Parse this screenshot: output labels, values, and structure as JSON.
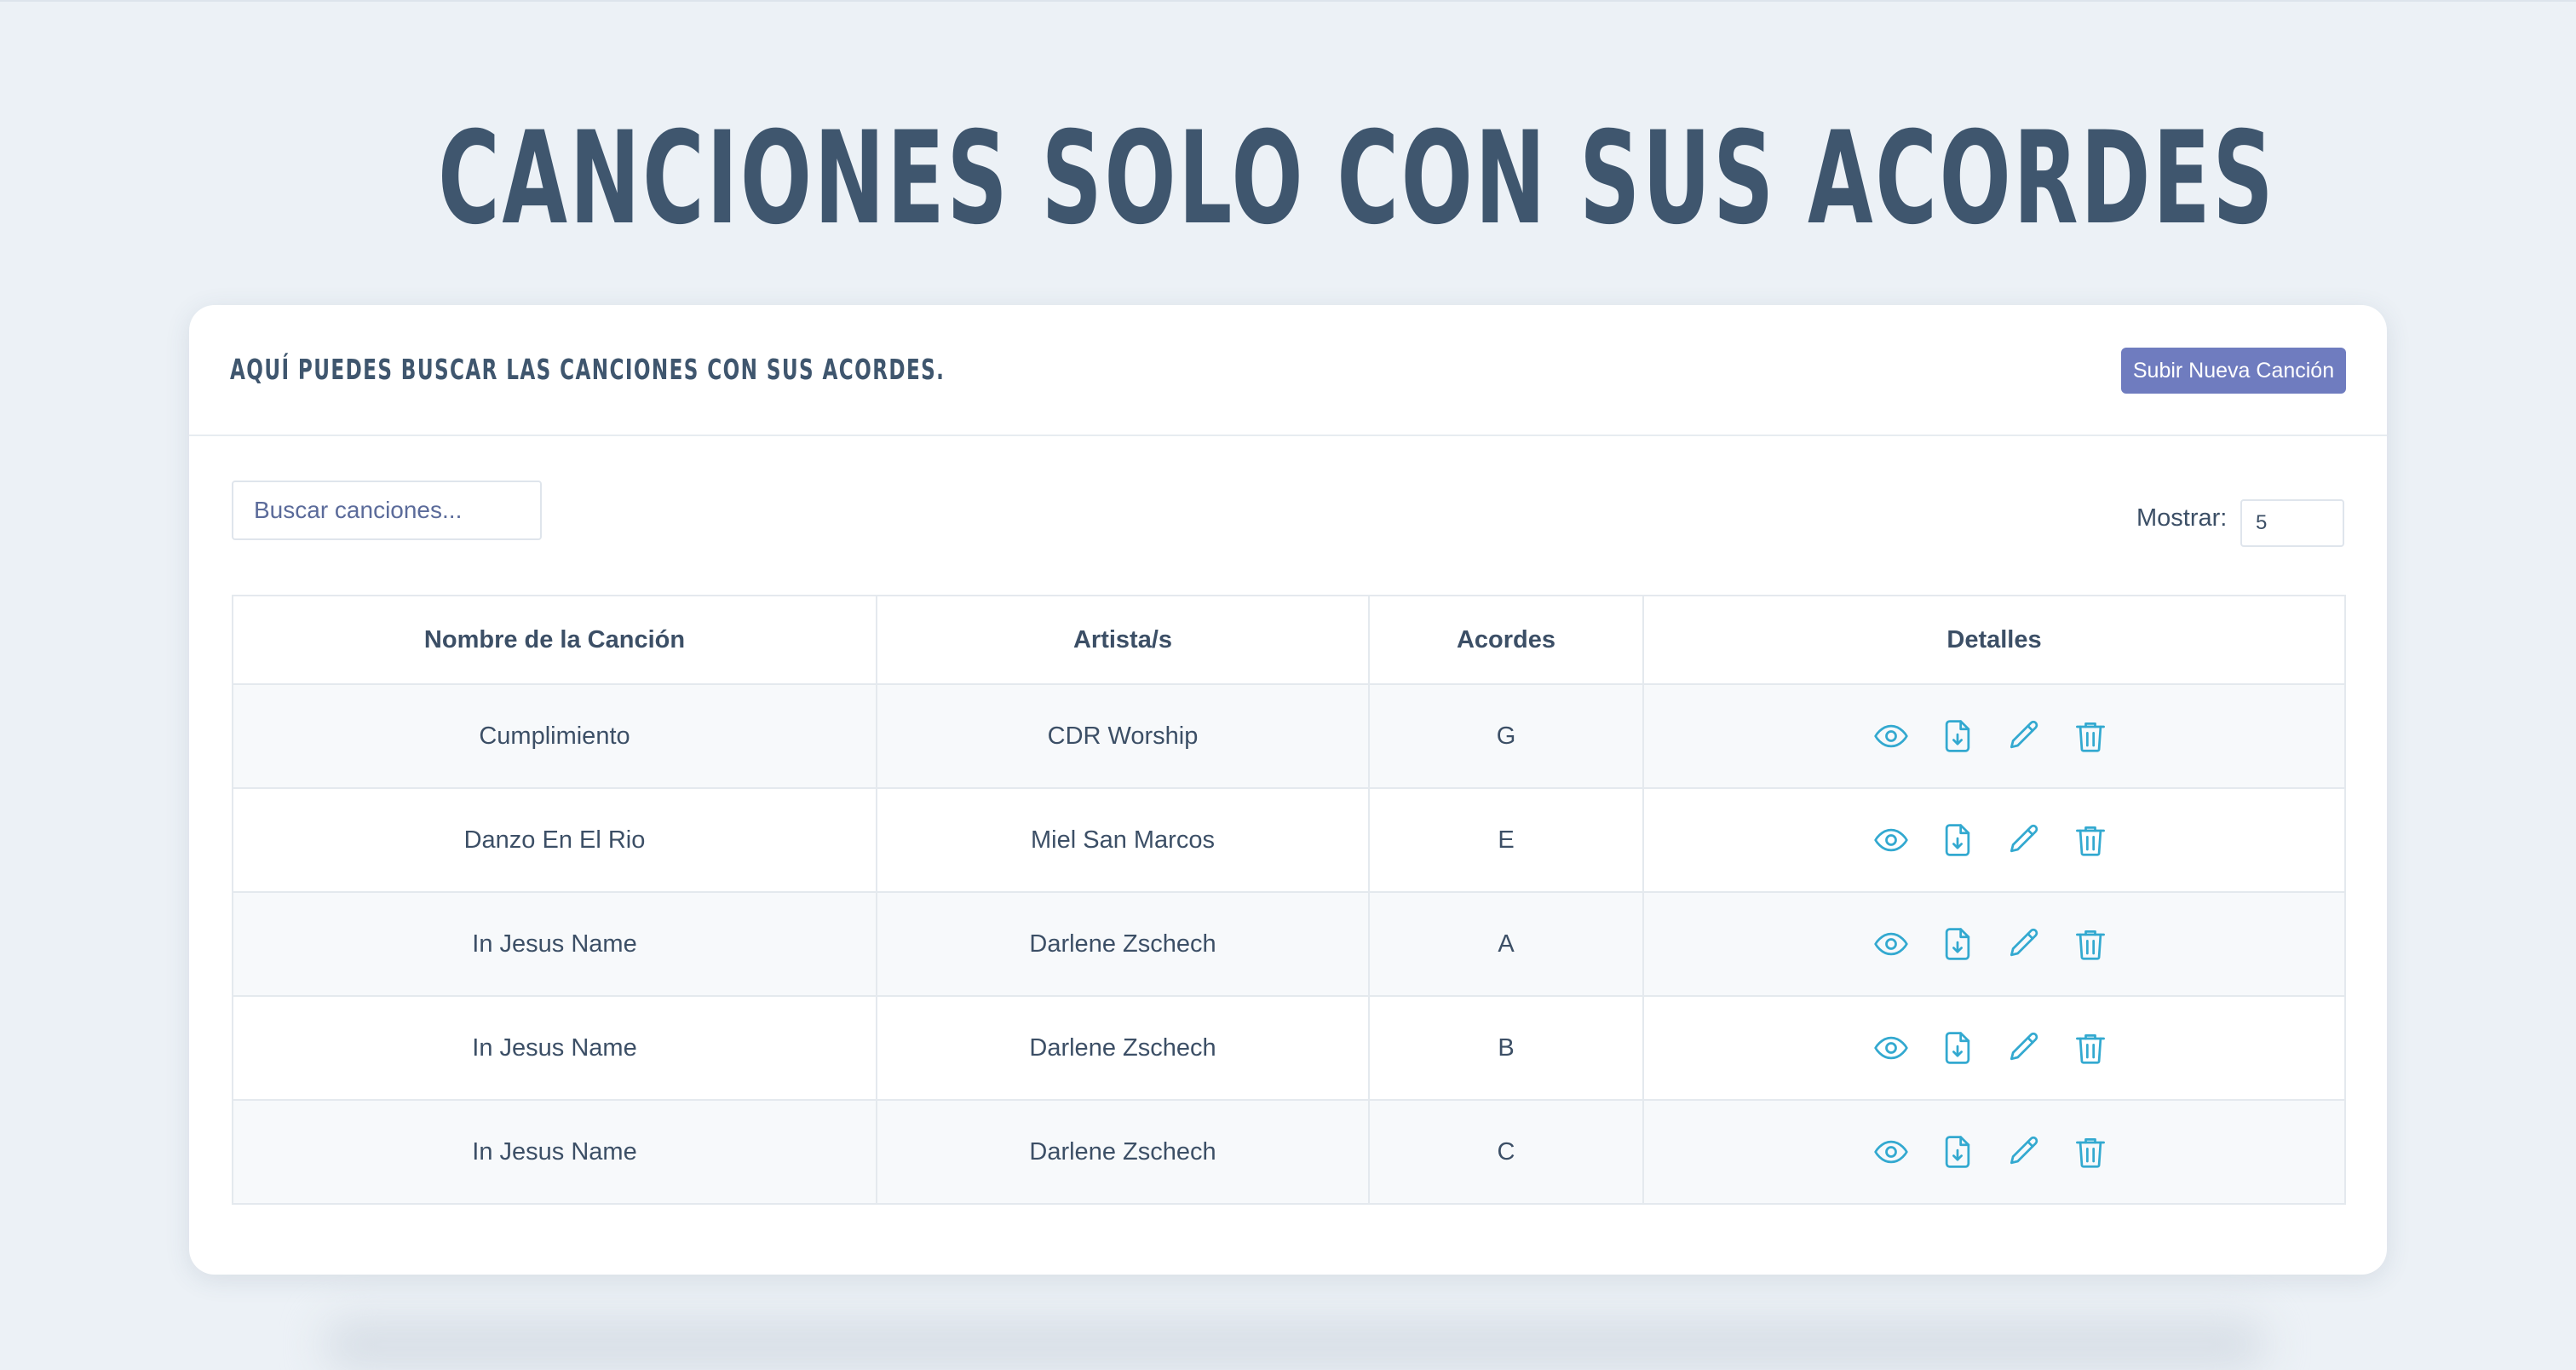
{
  "page": {
    "title": "CANCIONES SOLO CON SUS ACORDES"
  },
  "card": {
    "subtitle": "AQUÍ PUEDES BUSCAR LAS CANCIONES CON SUS ACORDES.",
    "upload_label": "Subir Nueva Canción"
  },
  "search": {
    "placeholder": "Buscar canciones...",
    "value": ""
  },
  "show": {
    "label": "Mostrar:",
    "value": "5"
  },
  "table": {
    "headers": [
      "Nombre de la Canción",
      "Artista/s",
      "Acordes",
      "Detalles"
    ],
    "rows": [
      {
        "name": "Cumplimiento",
        "artist": "CDR Worship",
        "chord": "G"
      },
      {
        "name": "Danzo En El Rio",
        "artist": "Miel San Marcos",
        "chord": "E"
      },
      {
        "name": "In Jesus Name",
        "artist": "Darlene Zschech",
        "chord": "A"
      },
      {
        "name": "In Jesus Name",
        "artist": "Darlene Zschech",
        "chord": "B"
      },
      {
        "name": "In Jesus Name",
        "artist": "Darlene Zschech",
        "chord": "C"
      }
    ],
    "row_actions": [
      "eye-icon",
      "file-download-icon",
      "pencil-icon",
      "trash-icon"
    ]
  },
  "colors": {
    "background": "#ecf1f6",
    "title": "#3f566e",
    "button": "#6f7cbf",
    "icon": "#33a9d0"
  }
}
